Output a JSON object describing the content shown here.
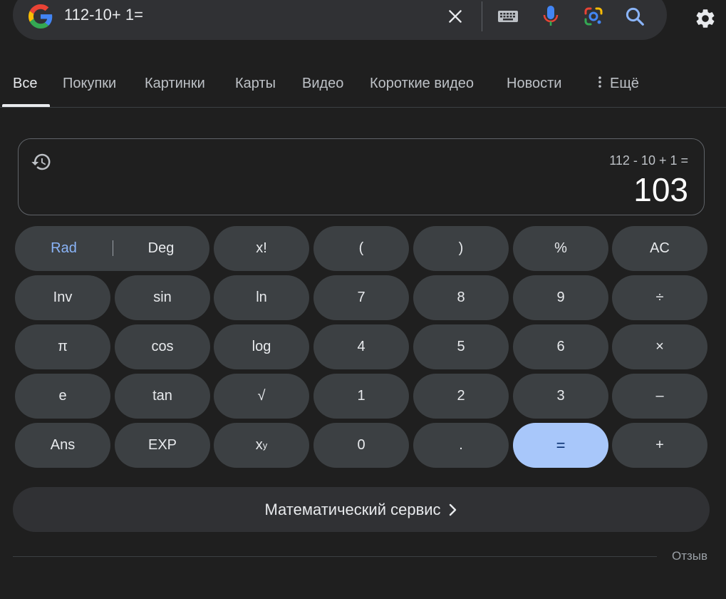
{
  "search": {
    "query": "112-10+ 1="
  },
  "tabs": [
    {
      "label": "Все",
      "active": true
    },
    {
      "label": "Покупки"
    },
    {
      "label": "Картинки"
    },
    {
      "label": "Карты"
    },
    {
      "label": "Видео"
    },
    {
      "label": "Короткие видео"
    },
    {
      "label": "Новости"
    },
    {
      "label": "Ещё"
    }
  ],
  "calculator": {
    "expression": "112 - 10 + 1 =",
    "result": "103",
    "keys": {
      "rad": "Rad",
      "deg": "Deg",
      "fact": "x!",
      "lparen": "(",
      "rparen": ")",
      "percent": "%",
      "ac": "AC",
      "inv": "Inv",
      "sin": "sin",
      "ln": "ln",
      "n7": "7",
      "n8": "8",
      "n9": "9",
      "divide": "÷",
      "pi": "π",
      "cos": "cos",
      "log": "log",
      "n4": "4",
      "n5": "5",
      "n6": "6",
      "multiply": "×",
      "e": "e",
      "tan": "tan",
      "sqrt": "√",
      "n1": "1",
      "n2": "2",
      "n3": "3",
      "minus": "–",
      "ans": "Ans",
      "exp": "EXP",
      "pow_base": "x",
      "pow_sup": "y",
      "n0": "0",
      "dot": ".",
      "equals": "=",
      "plus": "+"
    }
  },
  "math_service": "Математический сервис",
  "feedback": "Отзыв",
  "colors": {
    "background": "#1f1f1f",
    "key": "#3c4043",
    "equals_key": "#a8c7fa",
    "rad_active": "#8ab4f8"
  }
}
